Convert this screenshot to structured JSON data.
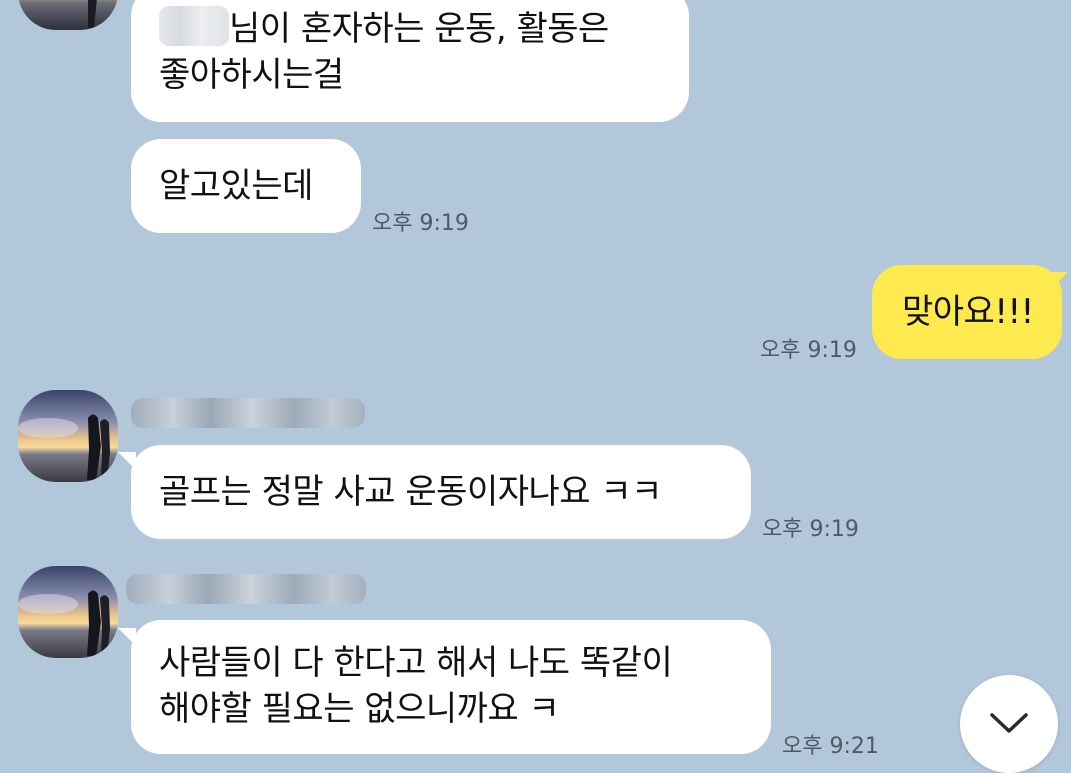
{
  "messages": [
    {
      "id": "m1",
      "sender": "other",
      "lines": [
        "님이 혼자하는 운동, 활동은",
        "좋아하시는걸"
      ],
      "redacted_name": true
    },
    {
      "id": "m2",
      "sender": "other",
      "text": "알고있는데",
      "time": "오후 9:19"
    },
    {
      "id": "m3",
      "sender": "me",
      "text": "맞아요!!!",
      "time": "오후 9:19"
    },
    {
      "id": "m4",
      "sender": "other",
      "text": "골프는 정말 사교 운동이자나요 ㅋㅋ",
      "time": "오후 9:19"
    },
    {
      "id": "m5",
      "sender": "other",
      "lines": [
        "사람들이 다 한다고 해서 나도 똑같이",
        "해야할 필요는 없으니까요 ㅋ"
      ],
      "time": "오후 9:21"
    }
  ],
  "icons": {
    "avatar": "profile-photo-sunset-couple",
    "scroll": "chevron-down-icon"
  },
  "colors": {
    "background": "#b2c7da",
    "bubble_other": "#ffffff",
    "bubble_mine": "#fee94f",
    "time_text": "#4d5a66"
  }
}
